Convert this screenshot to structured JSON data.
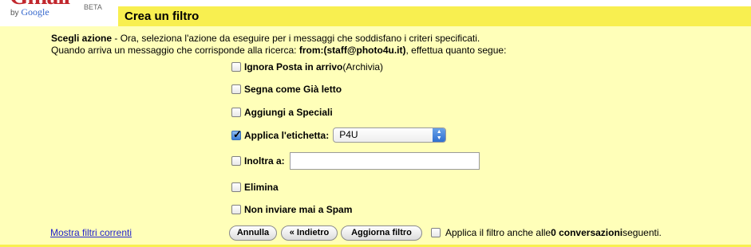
{
  "logo": {
    "by": "by",
    "google": "Google",
    "beta": "BETA"
  },
  "header": {
    "title": "Crea un filtro"
  },
  "intro": {
    "line1_bold": "Scegli azione",
    "line1_rest": " - Ora, seleziona l'azione da eseguire per i messaggi che soddisfano i criteri specificati.",
    "line2_start": "Quando arriva un messaggio che corrisponde alla ricerca: ",
    "line2_query": "from:(staff@photo4u.it)",
    "line2_end": ", effettua quanto segue:"
  },
  "actions": {
    "skip_inbox": {
      "label": "Ignora Posta in arrivo",
      "note": " (Archivia)",
      "checked": false
    },
    "mark_read": {
      "label": "Segna come Già letto",
      "checked": false
    },
    "star": {
      "label": "Aggiungi a Speciali",
      "checked": false
    },
    "apply_label": {
      "label": "Applica l'etichetta:",
      "checked": true,
      "selected": "P4U"
    },
    "forward": {
      "label": "Inoltra a:",
      "checked": false,
      "value": ""
    },
    "delete": {
      "label": "Elimina",
      "checked": false
    },
    "never_spam": {
      "label": "Non inviare mai a Spam",
      "checked": false
    }
  },
  "footer": {
    "show_filters": "Mostra filtri correnti",
    "cancel": "Annulla",
    "back": "« Indietro",
    "update": "Aggiorna filtro",
    "apply_also_prefix": "Applica il filtro anche alle ",
    "apply_also_count": "0 conversazioni",
    "apply_also_suffix": " seguenti."
  },
  "colors": {
    "title_bar": "#f8ef50",
    "panel": "#ffffb9",
    "link": "#2222cc"
  }
}
